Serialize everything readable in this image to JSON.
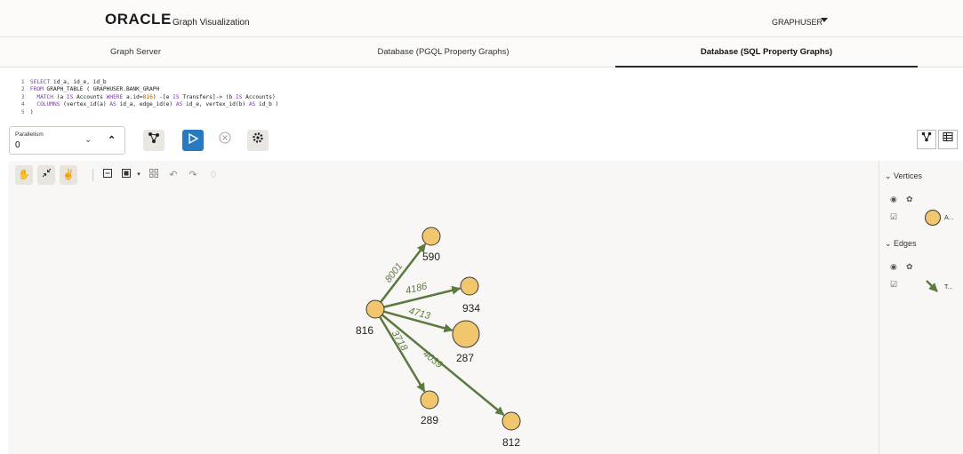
{
  "header": {
    "logo": "ORACLE",
    "app_title": "Graph Visualization",
    "user": "GRAPHUSER"
  },
  "tabs": [
    {
      "label": "Graph Server"
    },
    {
      "label": "Database (PGQL Property Graphs)"
    },
    {
      "label": "Database (SQL Property Graphs)"
    }
  ],
  "editor": {
    "lines": [
      {
        "n": "1",
        "text": "SELECT id_a, id_e, id_b"
      },
      {
        "n": "2",
        "text": "FROM GRAPH_TABLE ( GRAPHUSER.BANK_GRAPH"
      },
      {
        "n": "3",
        "text": "MATCH (a IS Accounts WHERE a.id=816) -[e IS Transfers]-> (b IS Accounts)"
      },
      {
        "n": "4",
        "text": "COLUMNS (vertex_id(a) AS id_a, edge_id(e) AS id_e, vertex_id(b) AS id_b )"
      },
      {
        "n": "5",
        "text": ")"
      }
    ]
  },
  "toolbar": {
    "parallelism_label": "Parallelism",
    "parallelism_value": "0"
  },
  "sidebar": {
    "vertices_label": "Vertices",
    "vertices_legend": "A...",
    "edges_label": "Edges",
    "edges_legend": "T..."
  },
  "graph": {
    "vertex_color": "#f2c66d",
    "vertex_stroke": "#3b3b3b",
    "edge_color": "#5b7a3f",
    "nodes": [
      {
        "id": "816",
        "label": "816"
      },
      {
        "id": "590",
        "label": "590"
      },
      {
        "id": "934",
        "label": "934"
      },
      {
        "id": "287",
        "label": "287"
      },
      {
        "id": "289",
        "label": "289"
      },
      {
        "id": "812",
        "label": "812"
      }
    ],
    "edges": [
      {
        "from": "816",
        "to": "590",
        "label": "8001"
      },
      {
        "from": "816",
        "to": "934",
        "label": "4186"
      },
      {
        "from": "816",
        "to": "287",
        "label": "4713"
      },
      {
        "from": "816",
        "to": "289",
        "label": "3718"
      },
      {
        "from": "816",
        "to": "812",
        "label": "4039"
      }
    ]
  }
}
